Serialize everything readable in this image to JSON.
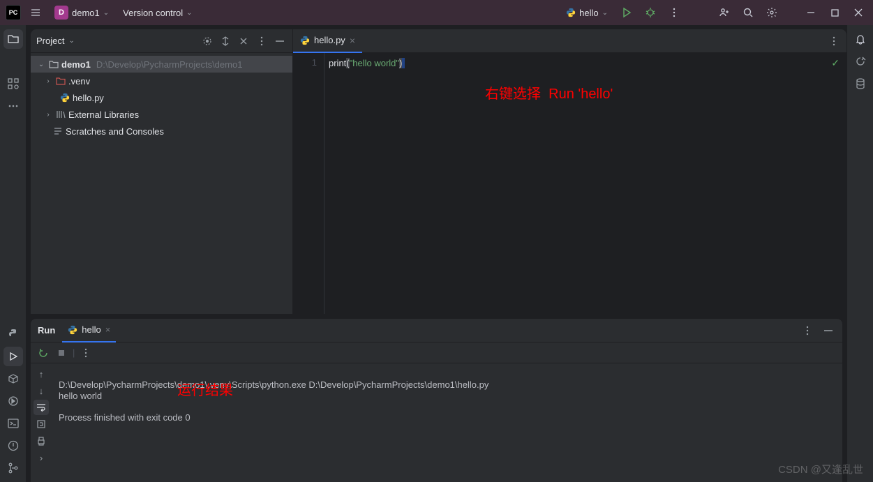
{
  "topbar": {
    "app": "PC",
    "project_initial": "D",
    "project_name": "demo1",
    "vcs": "Version control",
    "run_config": "hello"
  },
  "project_panel": {
    "title": "Project",
    "root": {
      "name": "demo1",
      "path": "D:\\Develop\\PycharmProjects\\demo1"
    },
    "venv": ".venv",
    "file": "hello.py",
    "ext_lib": "External Libraries",
    "scratches": "Scratches and Consoles"
  },
  "editor": {
    "tab": "hello.py",
    "line_no": "1",
    "code": {
      "fn": "print",
      "open": "(",
      "str": "\"hello world\"",
      "close": ")"
    }
  },
  "annotation": {
    "editor_left": "右键选择",
    "editor_right": "Run 'hello'",
    "console": "运行结果"
  },
  "run": {
    "title": "Run",
    "tab": "hello",
    "cmd": "D:\\Develop\\PycharmProjects\\demo1\\.venv\\Scripts\\python.exe D:\\Develop\\PycharmProjects\\demo1\\hello.py",
    "out": "hello world",
    "exit": "Process finished with exit code 0"
  },
  "watermark": "CSDN @又逢乱世"
}
